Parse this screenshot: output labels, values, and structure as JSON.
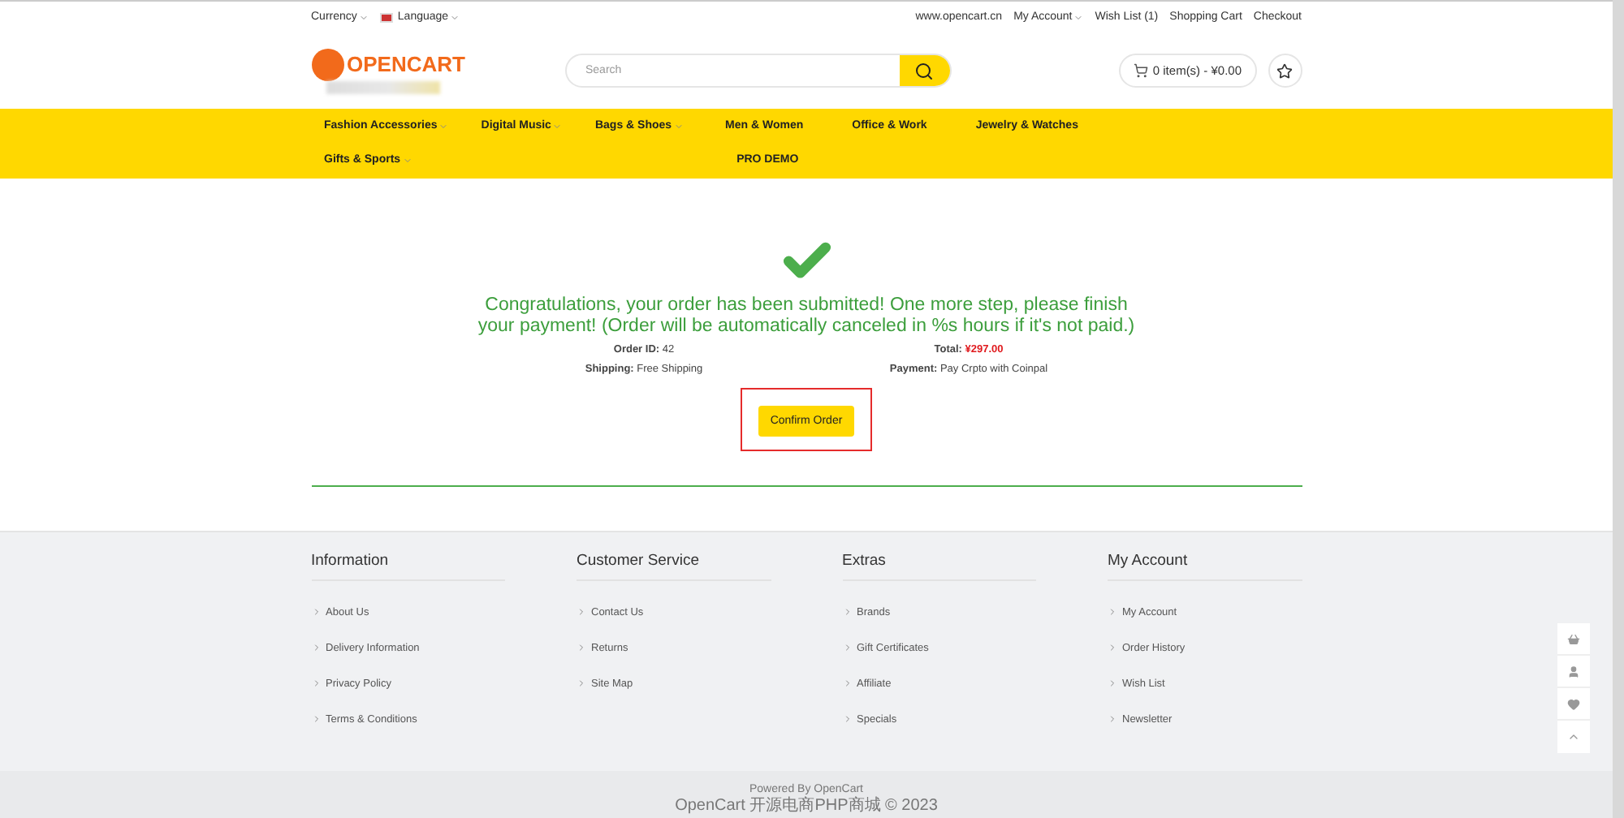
{
  "top_bar": {
    "left": [
      {
        "label": "Currency",
        "dropdown": true,
        "flag": false
      },
      {
        "label": "Language",
        "dropdown": true,
        "flag": true
      }
    ],
    "right": [
      {
        "label": "www.opencart.cn",
        "dropdown": false
      },
      {
        "label": "My Account",
        "dropdown": true
      },
      {
        "label": "Wish List (1)",
        "dropdown": false
      },
      {
        "label": "Shopping Cart",
        "dropdown": false
      },
      {
        "label": "Checkout",
        "dropdown": false
      }
    ]
  },
  "header": {
    "logo": "OPENCART",
    "search": {
      "placeholder": "Search"
    },
    "cart": "0 item(s) - ¥0.00"
  },
  "nav": [
    {
      "label": "Fashion Accessories",
      "dropdown": true
    },
    {
      "label": "Digital Music",
      "dropdown": true
    },
    {
      "label": "Bags & Shoes",
      "dropdown": true
    },
    {
      "label": "Men & Women",
      "dropdown": false
    },
    {
      "label": "Office & Work",
      "dropdown": false
    },
    {
      "label": "Jewelry & Watches",
      "dropdown": false
    },
    {
      "label": "Gifts & Sports",
      "dropdown": true
    },
    {
      "label": "PRO DEMO",
      "dropdown": false
    }
  ],
  "success": {
    "message": "Congratulations, your order has been submitted! One more step, please finish your payment! (Order will be automatically canceled in %s hours if it's not paid.)",
    "details": [
      {
        "label": "Order ID:",
        "value": "42",
        "highlight": false
      },
      {
        "label": "Total:",
        "value": "¥297.00",
        "highlight": true
      },
      {
        "label": "Shipping:",
        "value": "Free Shipping",
        "highlight": false
      },
      {
        "label": "Payment:",
        "value": "Pay Crpto with Coinpal",
        "highlight": false
      }
    ],
    "button": "Confirm Order"
  },
  "footer": {
    "columns": [
      {
        "title": "Information",
        "links": [
          "About Us",
          "Delivery Information",
          "Privacy Policy",
          "Terms & Conditions"
        ]
      },
      {
        "title": "Customer Service",
        "links": [
          "Contact Us",
          "Returns",
          "Site Map"
        ]
      },
      {
        "title": "Extras",
        "links": [
          "Brands",
          "Gift Certificates",
          "Affiliate",
          "Specials"
        ]
      },
      {
        "title": "My Account",
        "links": [
          "My Account",
          "Order History",
          "Wish List",
          "Newsletter"
        ]
      }
    ],
    "powered": "Powered By OpenCart",
    "copyright": "OpenCart 开源电商PHP商城 © 2023"
  },
  "side_toolbar": [
    {
      "kind": "basket"
    },
    {
      "kind": "user"
    },
    {
      "kind": "heart"
    },
    {
      "kind": "up"
    }
  ]
}
